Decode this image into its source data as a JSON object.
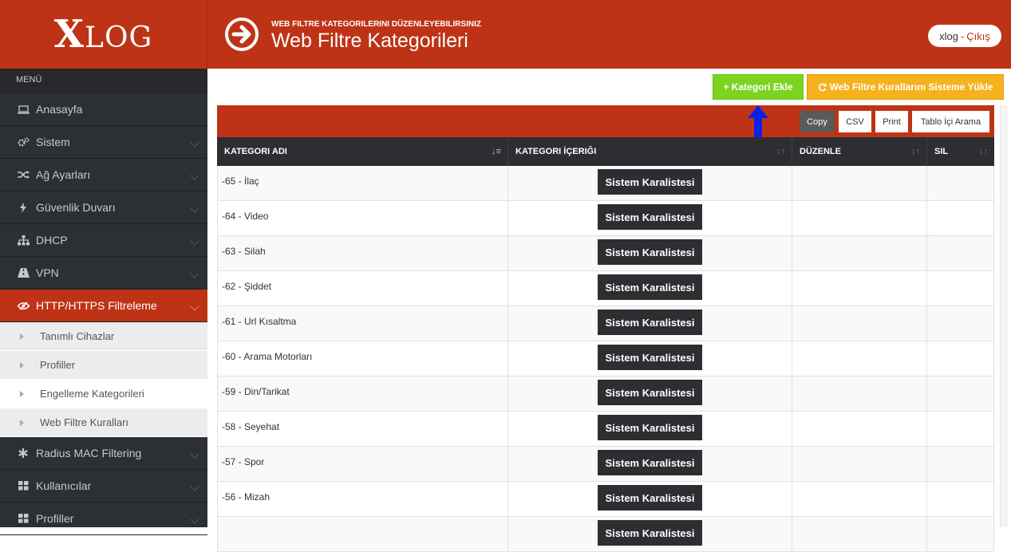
{
  "header": {
    "logo": "XLOG",
    "subtitle": "WEB FILTRE KATEGORILERINI DÜZENLEYEBILIRSINIZ",
    "title": "Web Filtre Kategorileri",
    "user": "xlog",
    "separator": "-",
    "logout": "Çıkış"
  },
  "sidebar": {
    "menu_label": "MENÜ",
    "items": [
      {
        "label": "Anasayfa",
        "icon": "laptop-icon"
      },
      {
        "label": "Sistem",
        "icon": "cogs-icon"
      },
      {
        "label": "Ağ Ayarları",
        "icon": "shuffle-icon"
      },
      {
        "label": "Güvenlik Duvarı",
        "icon": "bolt-icon"
      },
      {
        "label": "DHCP",
        "icon": "sitemap-icon"
      },
      {
        "label": "VPN",
        "icon": "road-icon"
      },
      {
        "label": "HTTP/HTTPS Filtreleme",
        "icon": "eye-slash-icon"
      }
    ],
    "sub_items": [
      {
        "label": "Tanımlı Cihazlar"
      },
      {
        "label": "Profiller"
      },
      {
        "label": "Engelleme Kategorileri"
      },
      {
        "label": "Web Filtre Kuralları"
      }
    ],
    "items_after": [
      {
        "label": "Radius MAC Filtering",
        "icon": "asterisk-icon"
      },
      {
        "label": "Kullanıcılar",
        "icon": "th-large-icon"
      },
      {
        "label": "Profiller",
        "icon": "th-large-icon"
      }
    ]
  },
  "actions": {
    "add_category": "+ Kategori Ekle",
    "load_rules": "Web Filtre Kurallarını Sisteme Yükle"
  },
  "table_tools": {
    "copy": "Copy",
    "csv": "CSV",
    "print": "Print",
    "search": "Tablo İçi Arama"
  },
  "table": {
    "headers": [
      "KATEGORI ADI",
      "KATEGORI İÇERIĞI",
      "DÜZENLE",
      "SIL"
    ],
    "rows": [
      {
        "name": "-65 - İlaç",
        "content": "Sistem Karalistesi"
      },
      {
        "name": "-64 - Video",
        "content": "Sistem Karalistesi"
      },
      {
        "name": "-63 - Silah",
        "content": "Sistem Karalistesi"
      },
      {
        "name": "-62 - Şiddet",
        "content": "Sistem Karalistesi"
      },
      {
        "name": "-61 - Url Kısaltma",
        "content": "Sistem Karalistesi"
      },
      {
        "name": "-60 - Arama Motorları",
        "content": "Sistem Karalistesi"
      },
      {
        "name": "-59 - Din/Tarikat",
        "content": "Sistem Karalistesi"
      },
      {
        "name": "-58 - Seyehat",
        "content": "Sistem Karalistesi"
      },
      {
        "name": "-57 - Spor",
        "content": "Sistem Karalistesi"
      },
      {
        "name": "-56 - Mizah",
        "content": "Sistem Karalistesi"
      },
      {
        "name": "",
        "content": "Sistem Karalistesi"
      }
    ]
  },
  "colors": {
    "brand": "#be3316",
    "sidebar": "#2d3033",
    "green": "#7ed321",
    "yellow": "#f6b21c",
    "arrow": "#0a22e8"
  }
}
